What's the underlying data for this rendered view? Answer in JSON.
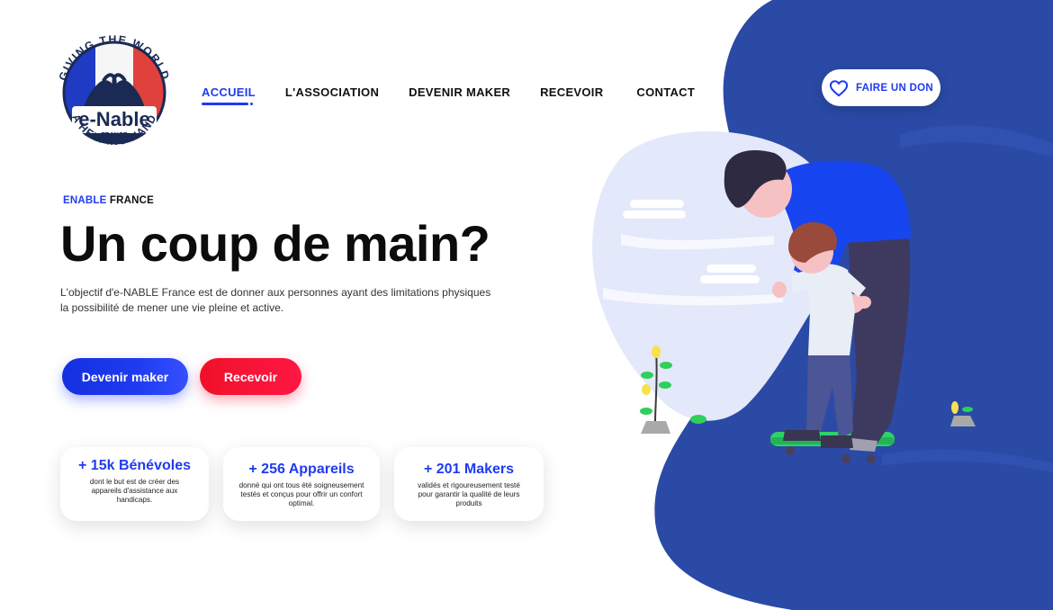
{
  "logo": {
    "arc_top": "GIVING THE WORLD",
    "name": "e-Nable",
    "country": "FRANCE",
    "arc_bottom": "A HELPING HAND"
  },
  "nav": {
    "items": [
      {
        "label": "ACCUEIL",
        "active": true
      },
      {
        "label": "L'ASSOCIATION",
        "active": false
      },
      {
        "label": "DEVENIR MAKER",
        "active": false
      },
      {
        "label": "RECEVOIR",
        "active": false
      },
      {
        "label": "CONTACT",
        "active": false
      }
    ]
  },
  "donate": {
    "label": "FAIRE UN DON",
    "icon": "heart-icon"
  },
  "hero": {
    "kicker_blue": "ENABLE",
    "kicker_dark": " FRANCE",
    "headline": "Un coup de main?",
    "description": "L'objectif d'e-NABLE France est de donner aux personnes ayant des limitations physiques la possibilité de mener une vie pleine et active."
  },
  "buttons": {
    "maker": "Devenir maker",
    "receive": "Recevoir"
  },
  "stats": [
    {
      "title": "+ 15k Bénévoles",
      "text": "dont le but est de créer des appareils d'assistance aux handicaps."
    },
    {
      "title": "+ 256 Appareils",
      "text": "donné qui ont tous été soigneusement testés et conçus pour offrir un confort optimal."
    },
    {
      "title": "+ 201 Makers",
      "text": "validés et rigoureusement testé pour garantir la qualité de leurs produits"
    }
  ],
  "colors": {
    "brand_blue": "#1f3bf0",
    "accent_red": "#f0102a",
    "blob_blue": "#2848a8"
  }
}
